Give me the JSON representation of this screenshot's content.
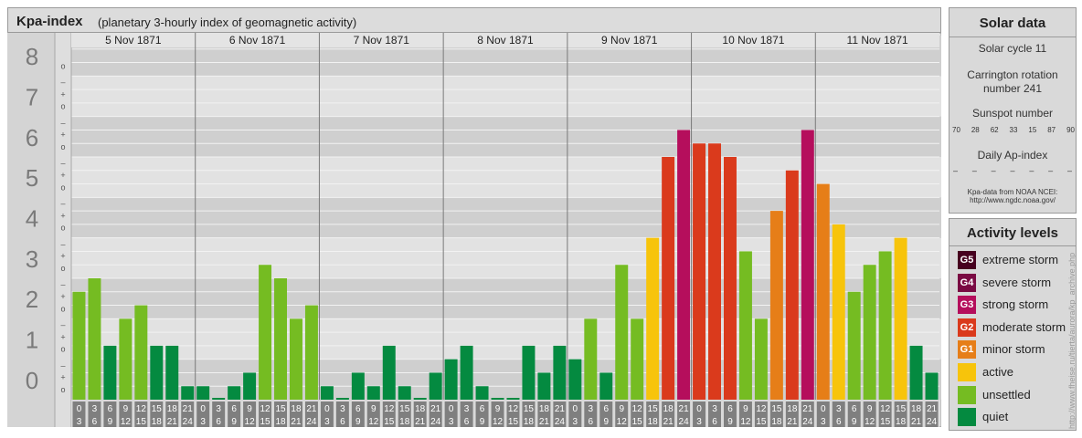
{
  "header": {
    "title": "Kpa-index",
    "subtitle": "(planetary 3-hourly index of geomagnetic activity)"
  },
  "chart_data": {
    "type": "bar",
    "ylim": [
      0,
      9
    ],
    "y_major_ticks": [
      "0",
      "1",
      "2",
      "3",
      "4",
      "5",
      "6",
      "7",
      "8",
      "9"
    ],
    "y_minor_ticks": [
      "o",
      "+",
      "–"
    ],
    "days": [
      "5 Nov 1871",
      "6 Nov 1871",
      "7 Nov 1871",
      "8 Nov 1871",
      "9 Nov 1871",
      "10 Nov 1871",
      "11 Nov 1871"
    ],
    "interval_starts": [
      "0",
      "3",
      "6",
      "9",
      "12",
      "15",
      "18",
      "21"
    ],
    "interval_ends": [
      "3",
      "6",
      "9",
      "12",
      "15",
      "18",
      "21",
      "24"
    ],
    "series": [
      {
        "values": [
          2.667,
          3,
          1.333,
          2,
          2.333,
          1.333,
          1.333,
          0.333,
          0.333,
          0,
          0.333,
          0.667,
          3.333,
          3,
          2,
          2.333,
          0.333,
          0,
          0.667,
          0.333,
          1.333,
          0.333,
          0,
          0.667,
          1,
          1.333,
          0.333,
          0,
          0,
          1.333,
          0.667,
          1.333,
          1,
          2,
          0.667,
          3.333,
          2,
          4,
          6,
          6.667,
          6.333,
          6.333,
          6,
          3.667,
          2,
          4.667,
          5.667,
          6.667,
          5.333,
          4.333,
          2.667,
          3.333,
          3.667,
          4,
          1.333,
          0.667
        ]
      }
    ],
    "colors": {
      "quiet": "#048a40",
      "unsettled": "#75bc22",
      "active": "#f7c40b",
      "minor_storm": "#e67e18",
      "moderate_storm": "#da3a1c",
      "strong_storm": "#b50e5c",
      "severe_storm": "#7a0a43",
      "extreme_storm": "#47001f"
    }
  },
  "solar": {
    "title": "Solar data",
    "cycle": "Solar cycle 11",
    "carrington_line1": "Carrington rotation",
    "carrington_line2": "number 241",
    "sunspot_title": "Sunspot number",
    "sunspot_values": [
      "70",
      "28",
      "62",
      "33",
      "15",
      "87",
      "90"
    ],
    "ap_title": "Daily Ap-index",
    "ap_values": [
      "–",
      "–",
      "–",
      "–",
      "–",
      "–",
      "–"
    ],
    "source_line1": "Kpa-data from NOAA NCEI:",
    "source_line2": "http://www.ngdc.noaa.gov/"
  },
  "legend": {
    "title": "Activity levels",
    "items": [
      {
        "badge": "G5",
        "label": "extreme storm",
        "color": "#47001f"
      },
      {
        "badge": "G4",
        "label": "severe storm",
        "color": "#7a0a43"
      },
      {
        "badge": "G3",
        "label": "strong storm",
        "color": "#b50e5c"
      },
      {
        "badge": "G2",
        "label": "moderate storm",
        "color": "#da3a1c"
      },
      {
        "badge": "G1",
        "label": "minor storm",
        "color": "#e67e18"
      },
      {
        "badge": "",
        "label": "active",
        "color": "#f7c40b"
      },
      {
        "badge": "",
        "label": "unsettled",
        "color": "#75bc22"
      },
      {
        "badge": "",
        "label": "quiet",
        "color": "#048a40"
      }
    ]
  },
  "credit": "http://www.fheise.ru/tierta/aurora/kp_archive.php"
}
